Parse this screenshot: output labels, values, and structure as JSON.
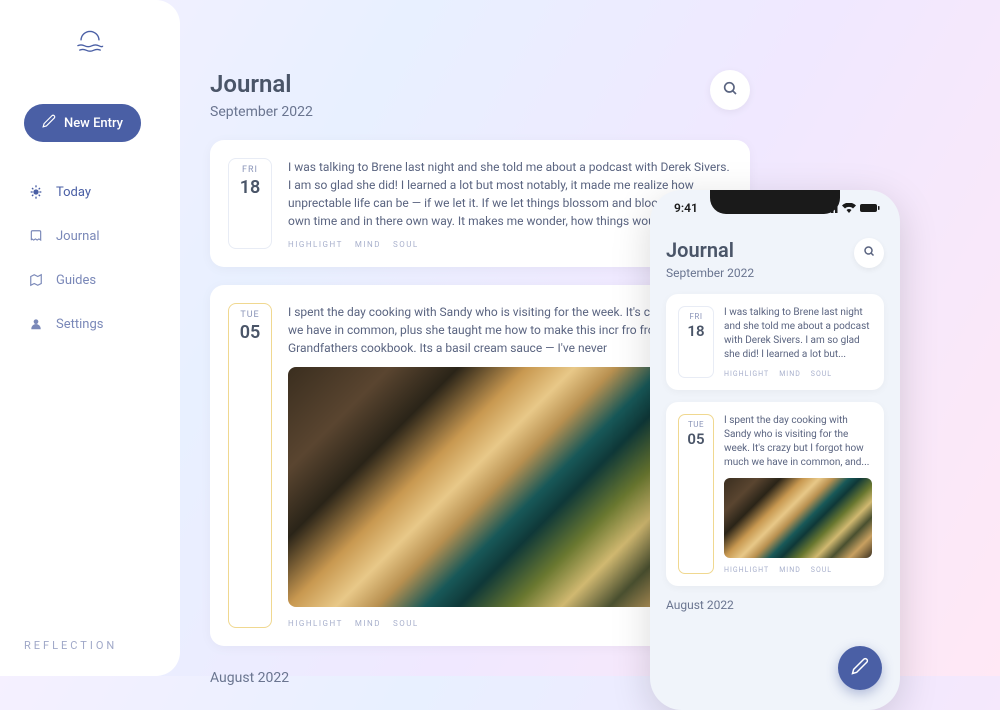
{
  "brand": "REFLECTION",
  "sidebar": {
    "new_entry": "New Entry",
    "items": [
      {
        "label": "Today"
      },
      {
        "label": "Journal"
      },
      {
        "label": "Guides"
      },
      {
        "label": "Settings"
      }
    ]
  },
  "main": {
    "title": "Journal",
    "subtitle": "September 2022",
    "entries": [
      {
        "day": "FRI",
        "num": "18",
        "text": "I was talking to Brene last night and she told me about a podcast with Derek Sivers. I am so glad she did! I learned a lot but most notably, it made me realize how unprectable life can be — if we let it. If we let things blossom and bloom in there own time and in there own way. It makes me wonder, how things would have b",
        "tags": [
          "HIGHLIGHT",
          "MIND",
          "SOUL"
        ]
      },
      {
        "day": "TUE",
        "num": "05",
        "text": "I spent the day cooking with Sandy who is visiting for the week. It's crazy how much we have in common, plus she taught me how to make this incr fro from her Grandfathers cookbook. Its a basil cream sauce — I've never",
        "tags": [
          "HIGHLIGHT",
          "MIND",
          "SOUL"
        ]
      }
    ],
    "prev_section": "August 2022"
  },
  "phone": {
    "time": "9:41",
    "title": "Journal",
    "subtitle": "September 2022",
    "entries": [
      {
        "day": "FRI",
        "num": "18",
        "text": "I was talking to Brene last night and she told me about a podcast with Derek Sivers. I am so glad she did! I learned a lot but...",
        "tags": [
          "HIGHLIGHT",
          "MIND",
          "SOUL"
        ]
      },
      {
        "day": "TUE",
        "num": "05",
        "text": "I spent the day cooking with Sandy who is visiting for the week. It's crazy but I forgot how much we have in common, and...",
        "tags": [
          "HIGHLIGHT",
          "MIND",
          "SOUL"
        ]
      }
    ],
    "prev_section": "August 2022"
  }
}
